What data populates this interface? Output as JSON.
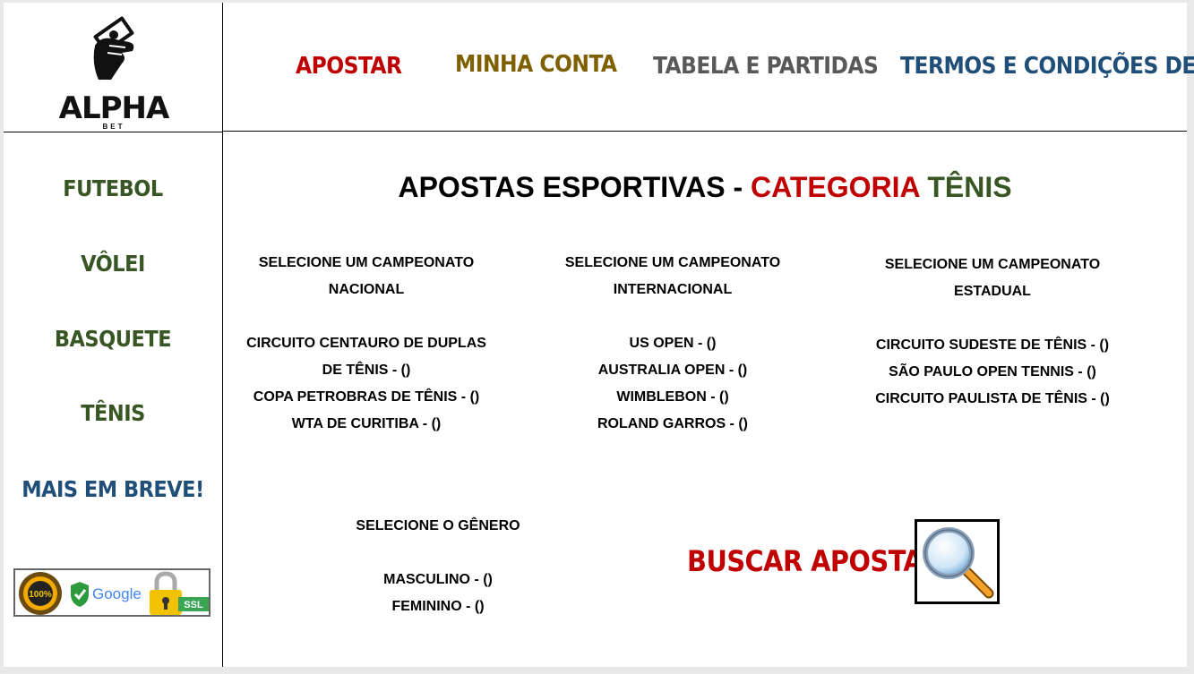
{
  "logo": {
    "name": "ALPHA",
    "sub": "BET"
  },
  "nav": [
    {
      "label": "APOSTAR",
      "color": "#c00000"
    },
    {
      "label": "MINHA CONTA",
      "color": "#7f6000"
    },
    {
      "label": "TABELA E PARTIDAS",
      "color": "#595959"
    },
    {
      "label": "TERMOS E CONDIÇÕES DE USO",
      "color": "#1f4e79"
    }
  ],
  "sidebar": {
    "items": [
      {
        "label": "FUTEBOL"
      },
      {
        "label": "VÔLEI"
      },
      {
        "label": "BASQUETE"
      },
      {
        "label": "TÊNIS"
      },
      {
        "label": "MAIS EM BREVE!"
      }
    ],
    "colors": {
      "sport": "#375623",
      "soon": "#1f4e79"
    },
    "badges": {
      "percent": "100%",
      "google": "Google",
      "ssl": "SSL"
    }
  },
  "main": {
    "title": {
      "part1": "APOSTAS ESPORTIVAS - ",
      "part2": "CATEGORIA",
      "part3": " TÊNIS"
    },
    "nacional": {
      "header_line1": "SELECIONE UM CAMPEONATO",
      "header_line2": "NACIONAL",
      "options": [
        "CIRCUITO CENTAURO DE DUPLAS",
        "DE TÊNIS - ()",
        "COPA PETROBRAS DE TÊNIS - ()",
        "WTA DE CURITIBA - ()"
      ]
    },
    "internacional": {
      "header_line1": "SELECIONE UM CAMPEONATO",
      "header_line2": "INTERNACIONAL",
      "options": [
        "US OPEN - ()",
        "AUSTRALIA OPEN - ()",
        "WIMBLEBON - ()",
        "ROLAND GARROS - ()"
      ]
    },
    "estadual": {
      "header_line1": "SELECIONE UM CAMPEONATO",
      "header_line2": "ESTADUAL",
      "options": [
        "CIRCUITO SUDESTE DE TÊNIS - ()",
        "SÃO PAULO OPEN TENNIS - ()",
        "CIRCUITO PAULISTA DE TÊNIS - ()"
      ]
    },
    "genero": {
      "header": "SELECIONE O GÊNERO",
      "options": [
        "MASCULINO - ()",
        "FEMININO - ()"
      ]
    },
    "buscar_label": "BUSCAR APOSTAS"
  },
  "colors": {
    "red": "#c00000",
    "green": "#375623"
  }
}
